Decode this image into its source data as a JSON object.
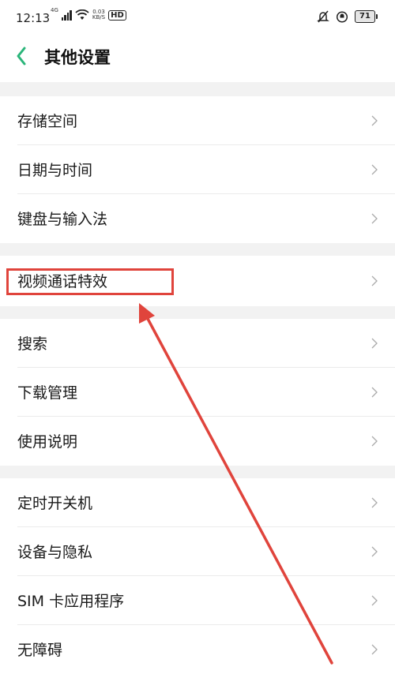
{
  "status_bar": {
    "time": "12:13",
    "signal_tag": "4G",
    "net_speed_value": "0.03",
    "net_speed_unit": "KB/S",
    "hd_label": "HD",
    "battery": "71"
  },
  "nav": {
    "title": "其他设置",
    "icon": "chevron-left-icon"
  },
  "colors": {
    "accent_green": "#2bb57a",
    "annotation_red": "#e0443c",
    "divider_gray": "#f2f2f2"
  },
  "groups": [
    {
      "items": [
        {
          "label": "存储空间"
        },
        {
          "label": "日期与时间"
        },
        {
          "label": "键盘与输入法"
        }
      ]
    },
    {
      "items": [
        {
          "label": "视频通话特效"
        }
      ]
    },
    {
      "items": [
        {
          "label": "搜索"
        },
        {
          "label": "下载管理"
        },
        {
          "label": "使用说明"
        }
      ]
    },
    {
      "items": [
        {
          "label": "定时开关机"
        },
        {
          "label": "设备与隐私"
        },
        {
          "label": "SIM 卡应用程序"
        },
        {
          "label": "无障碍"
        }
      ]
    }
  ]
}
